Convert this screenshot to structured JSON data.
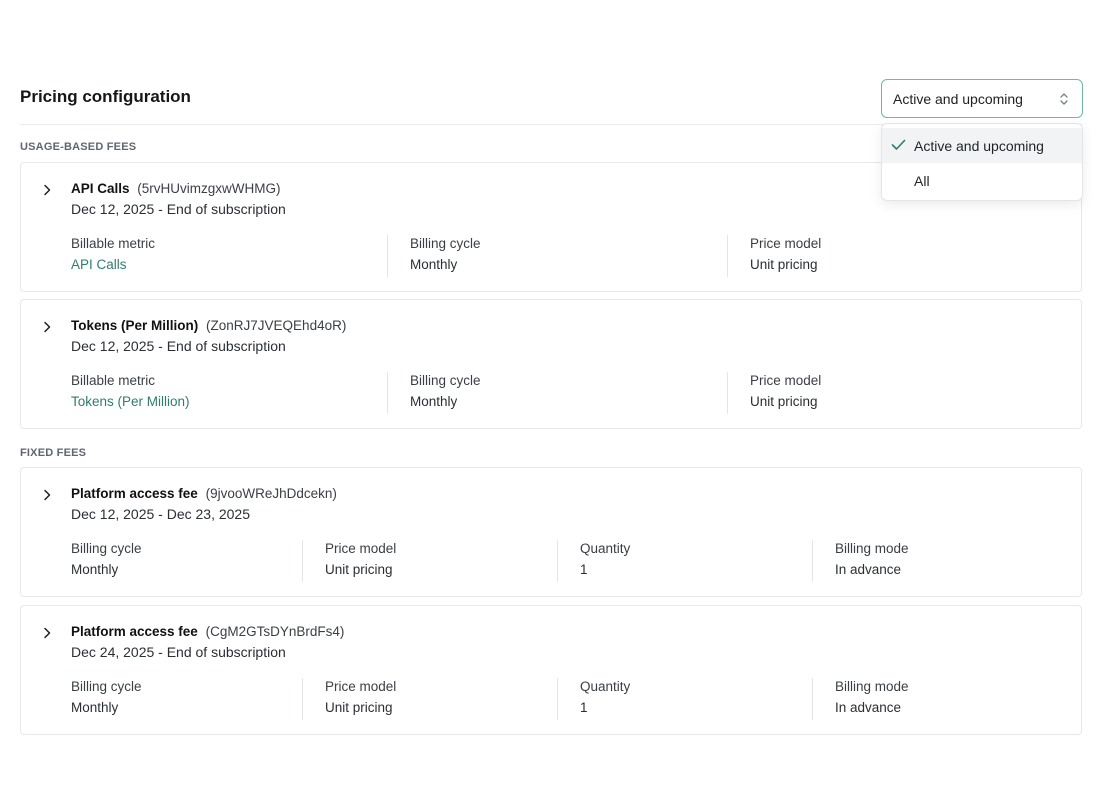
{
  "page": {
    "title": "Pricing configuration"
  },
  "filter": {
    "selected": "Active and upcoming",
    "options": [
      {
        "label": "Active and upcoming",
        "selected": true
      },
      {
        "label": "All",
        "selected": false
      }
    ]
  },
  "sections": {
    "usage_label": "USAGE-BASED FEES",
    "fixed_label": "FIXED FEES"
  },
  "usage_fees": [
    {
      "name": "API Calls",
      "code": "(5rvHUvimzgxwWHMG)",
      "dates": "Dec 12, 2025 - End of subscription",
      "billable_metric_label": "Billable metric",
      "billable_metric_value": "API Calls",
      "billing_cycle_label": "Billing cycle",
      "billing_cycle_value": "Monthly",
      "price_model_label": "Price model",
      "price_model_value": "Unit pricing"
    },
    {
      "name": "Tokens (Per Million)",
      "code": "(ZonRJ7JVEQEhd4oR)",
      "dates": "Dec 12, 2025 - End of subscription",
      "billable_metric_label": "Billable metric",
      "billable_metric_value": "Tokens (Per Million)",
      "billing_cycle_label": "Billing cycle",
      "billing_cycle_value": "Monthly",
      "price_model_label": "Price model",
      "price_model_value": "Unit pricing"
    }
  ],
  "fixed_fees": [
    {
      "name": "Platform access fee",
      "code": "(9jvooWReJhDdcekn)",
      "dates": "Dec 12, 2025 - Dec 23, 2025",
      "billing_cycle_label": "Billing cycle",
      "billing_cycle_value": "Monthly",
      "price_model_label": "Price model",
      "price_model_value": "Unit pricing",
      "quantity_label": "Quantity",
      "quantity_value": "1",
      "billing_mode_label": "Billing mode",
      "billing_mode_value": "In advance"
    },
    {
      "name": "Platform access fee",
      "code": "(CgM2GTsDYnBrdFs4)",
      "dates": "Dec 24, 2025 - End of subscription",
      "billing_cycle_label": "Billing cycle",
      "billing_cycle_value": "Monthly",
      "price_model_label": "Price model",
      "price_model_value": "Unit pricing",
      "quantity_label": "Quantity",
      "quantity_value": "1",
      "billing_mode_label": "Billing mode",
      "billing_mode_value": "In advance"
    }
  ],
  "colors": {
    "accent": "#2e7d6e",
    "focus_border": "#6fb8ac"
  }
}
